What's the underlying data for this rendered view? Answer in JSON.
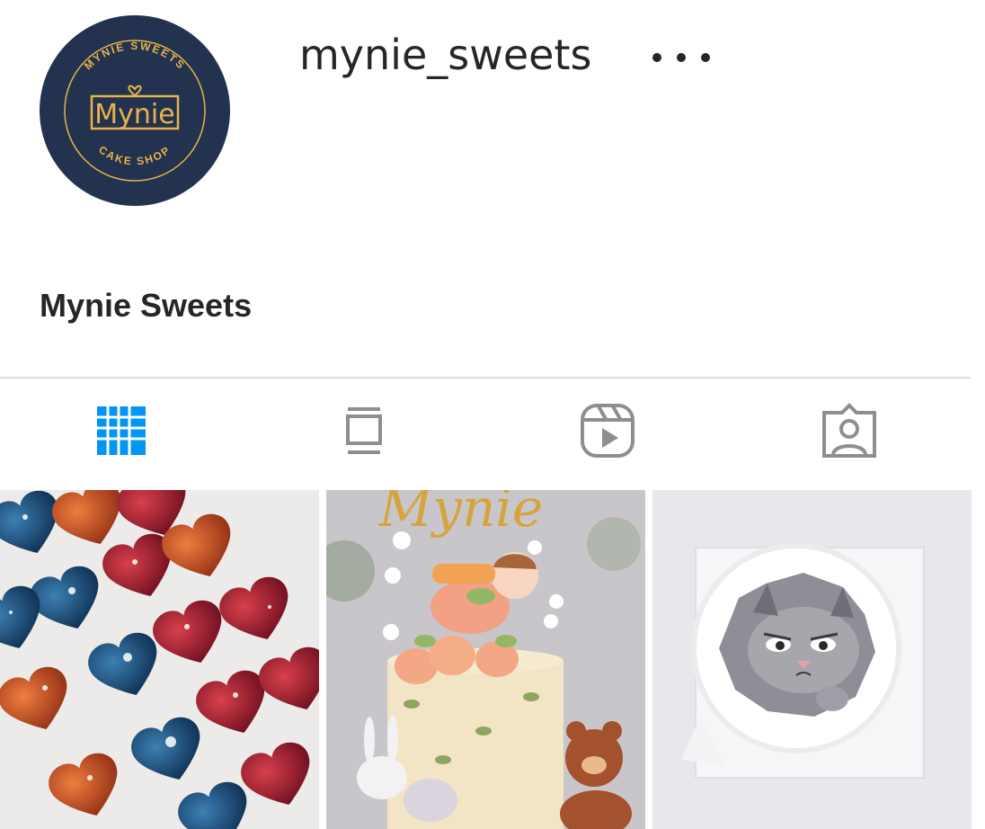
{
  "profile": {
    "username": "mynie_sweets",
    "display_name": "Mynie Sweets",
    "avatar": {
      "brand": "Mynie",
      "top_arc": "MYNIE SWEETS",
      "bottom_arc": "CAKE SHOP"
    }
  },
  "more_button_icon": "more-horizontal-icon",
  "tabs": [
    {
      "icon": "grid-icon",
      "active": true
    },
    {
      "icon": "guides-icon",
      "active": false
    },
    {
      "icon": "reels-icon",
      "active": false
    },
    {
      "icon": "tagged-icon",
      "active": false
    }
  ],
  "posts": [
    {
      "subject": "heart-chocolates-photo"
    },
    {
      "subject": "decorated-cake-photo",
      "lettering": "Mynie"
    },
    {
      "subject": "cat-cake-photo"
    }
  ],
  "colors": {
    "active_tab": "#0095f6",
    "inactive_tab": "#8e8e8e",
    "avatar_bg": "#22324f",
    "avatar_accent": "#e8b34a",
    "text": "#262626",
    "divider": "#dbdbdb"
  }
}
